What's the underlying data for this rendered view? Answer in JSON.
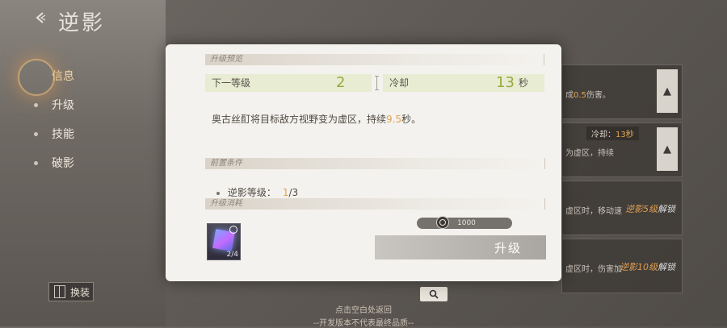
{
  "page": {
    "title": "逆影",
    "nav": {
      "items": [
        {
          "label": "信息",
          "active": true
        },
        {
          "label": "升级"
        },
        {
          "label": "技能"
        },
        {
          "label": "破影"
        }
      ]
    },
    "swap_label": "换装",
    "bottom_hint": "点击空白处返回",
    "dev_note": "--开发版本不代表最终品质--"
  },
  "right_cards": [
    {
      "text_prefix": "成",
      "text_highlight": "0.5",
      "text_suffix": "伤害。"
    },
    {
      "badge": "冷却：",
      "badge_value": "13秒",
      "text": "为虚区，持续"
    },
    {
      "text": "虚区时，移动速",
      "unlock_highlight": "逆影5级",
      "unlock_suffix": "解锁"
    },
    {
      "text": "虚区时，伤害加",
      "unlock_highlight": "逆影10级",
      "unlock_suffix": "解锁"
    }
  ],
  "dialog": {
    "section_preview": "升级预览",
    "next_level_label": "下一等级",
    "next_level_value": "2",
    "cooldown_label": "冷却",
    "cooldown_value": "13",
    "cooldown_unit": "秒",
    "desc_prefix": "奥古丝酊将目标敌方视野变为虚区，持续",
    "desc_highlight": "9.5",
    "desc_suffix": "秒。",
    "section_prereq": "前置条件",
    "prereq_label": "逆影等级：",
    "prereq_current": "1",
    "prereq_required": "/3",
    "section_cost": "升级消耗",
    "item_count": "2/4",
    "currency_value": "1000",
    "upgrade_label": "升级"
  },
  "colors": {
    "accent_orange": "#e0a44c",
    "stat_green": "#9aa83d"
  }
}
